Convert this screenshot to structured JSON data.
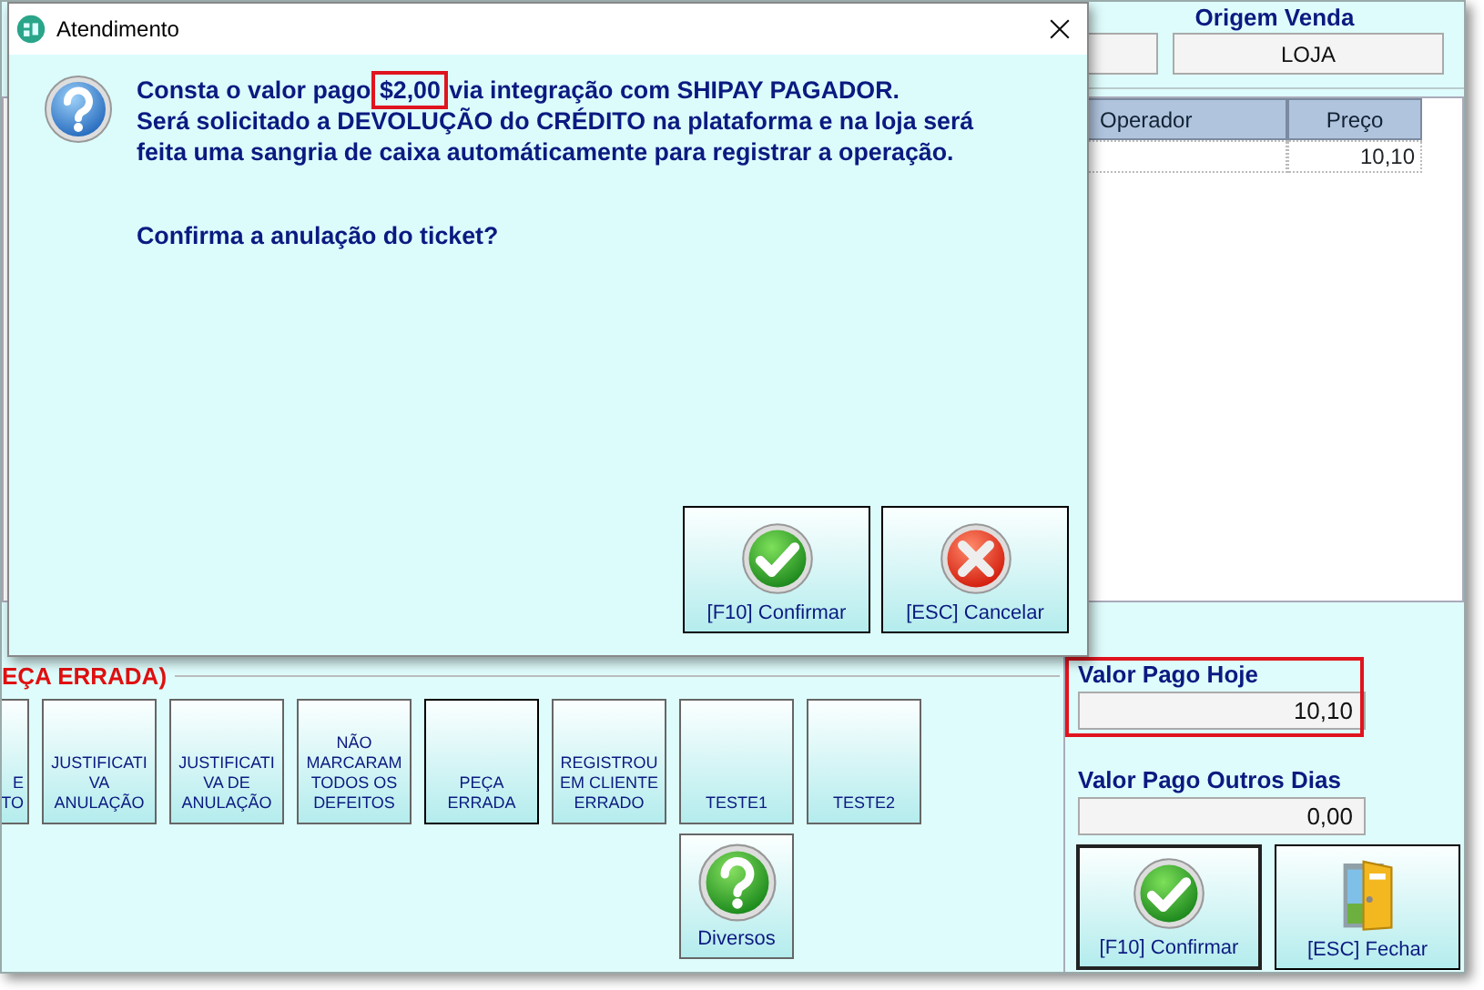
{
  "background_window": {
    "origin_panel": {
      "label": "Origem Venda",
      "value": "LOJA"
    },
    "table": {
      "columns": [
        "Operador",
        "Preço"
      ],
      "rows": [
        {
          "preco": "10,10"
        }
      ]
    },
    "reason_heading": "EÇA ERRADA)",
    "reason_buttons": [
      {
        "label": "E\nTO",
        "selected": false
      },
      {
        "label": "JUSTIFICATI\nVA\nANULAÇÃO",
        "selected": false
      },
      {
        "label": "JUSTIFICATI\nVA DE\nANULAÇÃO",
        "selected": false
      },
      {
        "label": "NÃO\nMARCARAM\nTODOS OS\nDEFEITOS",
        "selected": false
      },
      {
        "label": "PEÇA\nERRADA",
        "selected": true
      },
      {
        "label": "REGISTROU\nEM CLIENTE\nERRADO",
        "selected": false
      },
      {
        "label": "TESTE1",
        "selected": false
      },
      {
        "label": "TESTE2",
        "selected": false
      }
    ],
    "diversos_button": {
      "label": "Diversos"
    },
    "fields": [
      {
        "label": "Valor Pago Hoje",
        "value": "10,10",
        "highlighted": true
      },
      {
        "label": "Valor Pago Outros Dias",
        "value": "0,00",
        "highlighted": false
      }
    ],
    "buttons": [
      {
        "kind": "confirm",
        "label": "[F10] Confirmar",
        "focused": true
      },
      {
        "kind": "close",
        "label": "[ESC] Fechar",
        "focused": false
      }
    ]
  },
  "dialog": {
    "title": "Atendimento",
    "message": {
      "before": "Consta o valor pago ",
      "amount": "$2,00",
      "amount_highlighted": true,
      "after": " via integração com SHIPAY PAGADOR.\nSerá solicitado a DEVOLUÇÃO do CRÉDITO na plataforma e na loja será\nfeita uma sangria de caixa automáticamente para registrar a operação."
    },
    "question": "Confirma a anulação do ticket?",
    "buttons": [
      {
        "kind": "confirm",
        "label": "[F10] Confirmar"
      },
      {
        "kind": "cancel",
        "label": "[ESC] Cancelar"
      }
    ]
  }
}
